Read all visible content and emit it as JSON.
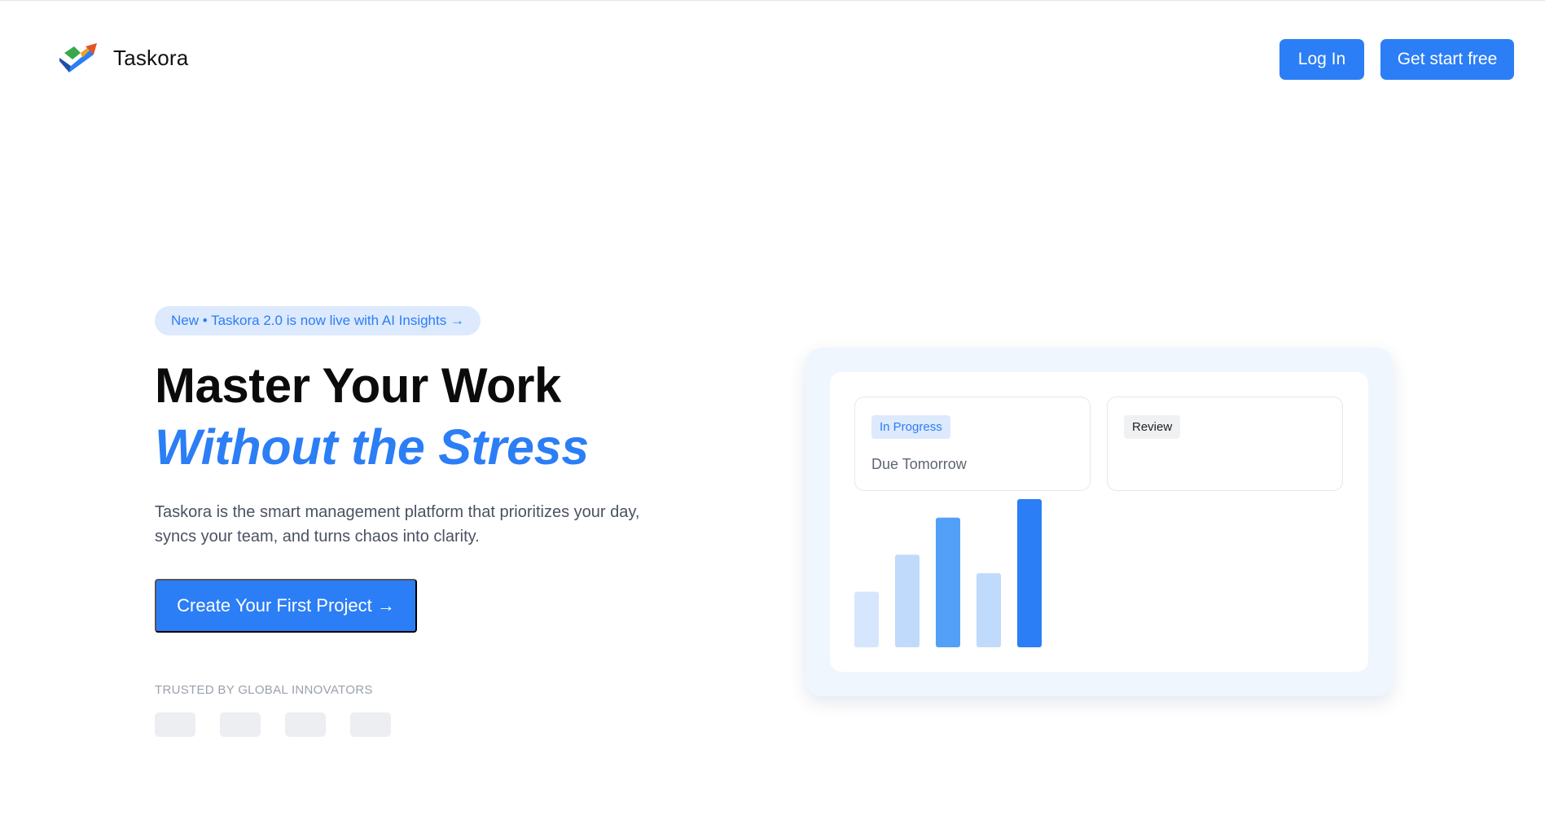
{
  "header": {
    "brand_name": "Taskora",
    "login_label": "Log In",
    "start_label": "Get start free"
  },
  "hero": {
    "announcement": "New • Taskora 2.0 is now live with AI Insights →",
    "title_line1": "Master Your Work",
    "title_line2": "Without the Stress",
    "subtitle": "Taskora is the smart management platform that prioritizes your day, syncs your team, and turns chaos into clarity.",
    "cta_label": "Create Your First Project →",
    "trusted_label": "TRUSTED BY GLOBAL INNOVATORS",
    "logo_count": 4
  },
  "preview": {
    "card1_tag": "In Progress",
    "card1_text": "Due Tomorrow",
    "card2_tag": "Review"
  },
  "chart_data": {
    "type": "bar",
    "categories": [
      "",
      "",
      "",
      "",
      ""
    ],
    "values": [
      30,
      50,
      70,
      40,
      80
    ],
    "ylim": [
      0,
      80
    ],
    "colors": [
      "#d6e6fd",
      "#c0dafc",
      "#52a0f8",
      "#c0dafc",
      "#2b7ef5"
    ],
    "title": "",
    "xlabel": "",
    "ylabel": ""
  },
  "colors": {
    "accent": "#2b7ef5",
    "accent_light": "#dde9fd",
    "text_dark": "#0b0b0b",
    "text_muted": "#4a5261"
  }
}
